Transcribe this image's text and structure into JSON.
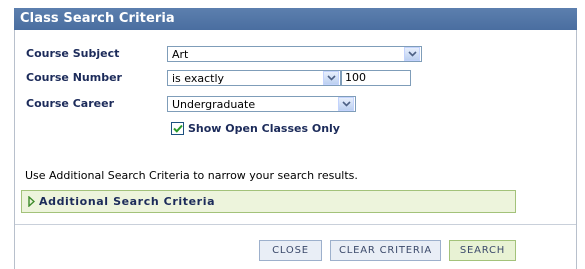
{
  "panel": {
    "title": "Class Search Criteria"
  },
  "fields": {
    "course_subject": {
      "label": "Course Subject",
      "value": "Art"
    },
    "course_number": {
      "label": "Course Number",
      "operator": "is exactly",
      "value": "100"
    },
    "course_career": {
      "label": "Course Career",
      "value": "Undergraduate"
    },
    "open_only": {
      "label": "Show Open Classes Only",
      "checked": true
    }
  },
  "info_text": "Use Additional Search Criteria to narrow your search results.",
  "additional": {
    "label": "Additional Search Criteria",
    "expanded": false
  },
  "buttons": {
    "close": "Close",
    "clear": "Clear Criteria",
    "search": "Search"
  },
  "colors": {
    "header_bg": "#4f72a5",
    "label_text": "#1c2b5a",
    "additional_bg": "#edf4dc",
    "search_bg": "#e8f2d4"
  },
  "icons": {
    "dropdown": "chevron-down-icon",
    "expand": "triangle-right-icon",
    "check": "checkmark-icon"
  }
}
